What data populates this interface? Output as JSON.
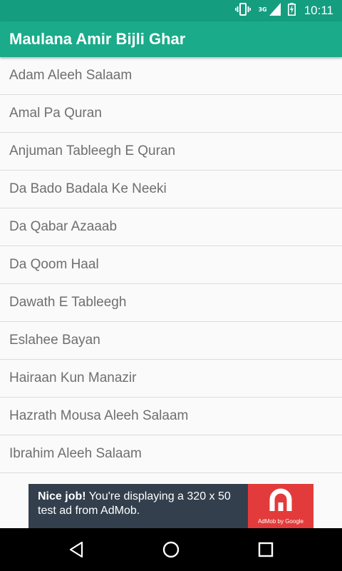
{
  "status_bar": {
    "time": "10:11",
    "network": "3G",
    "icons": [
      "vibrate-icon",
      "signal-icon",
      "battery-icon"
    ]
  },
  "app_bar": {
    "title": "Maulana Amir Bijli Ghar",
    "color": "#1aab8a",
    "status_color": "#159d80"
  },
  "list": {
    "items": [
      "Adam Aleeh Salaam",
      "Amal Pa Quran",
      "Anjuman Tableegh E Quran",
      "Da Bado Badala Ke Neeki",
      "Da Qabar Azaaab",
      "Da Qoom Haal",
      "Dawath E Tableegh",
      "Eslahee Bayan",
      "Hairaan Kun Manazir",
      "Hazrath Mousa Aleeh Salaam",
      "Ibrahim Aleeh Salaam"
    ]
  },
  "ad": {
    "headline": "Nice job!",
    "body": " You're displaying a 320 x 50 test ad from AdMob.",
    "logo_caption": "AdMob by Google",
    "logo_color": "#e33b3b"
  },
  "nav_bar": {
    "buttons": [
      "back-icon",
      "home-icon",
      "recents-icon"
    ]
  }
}
